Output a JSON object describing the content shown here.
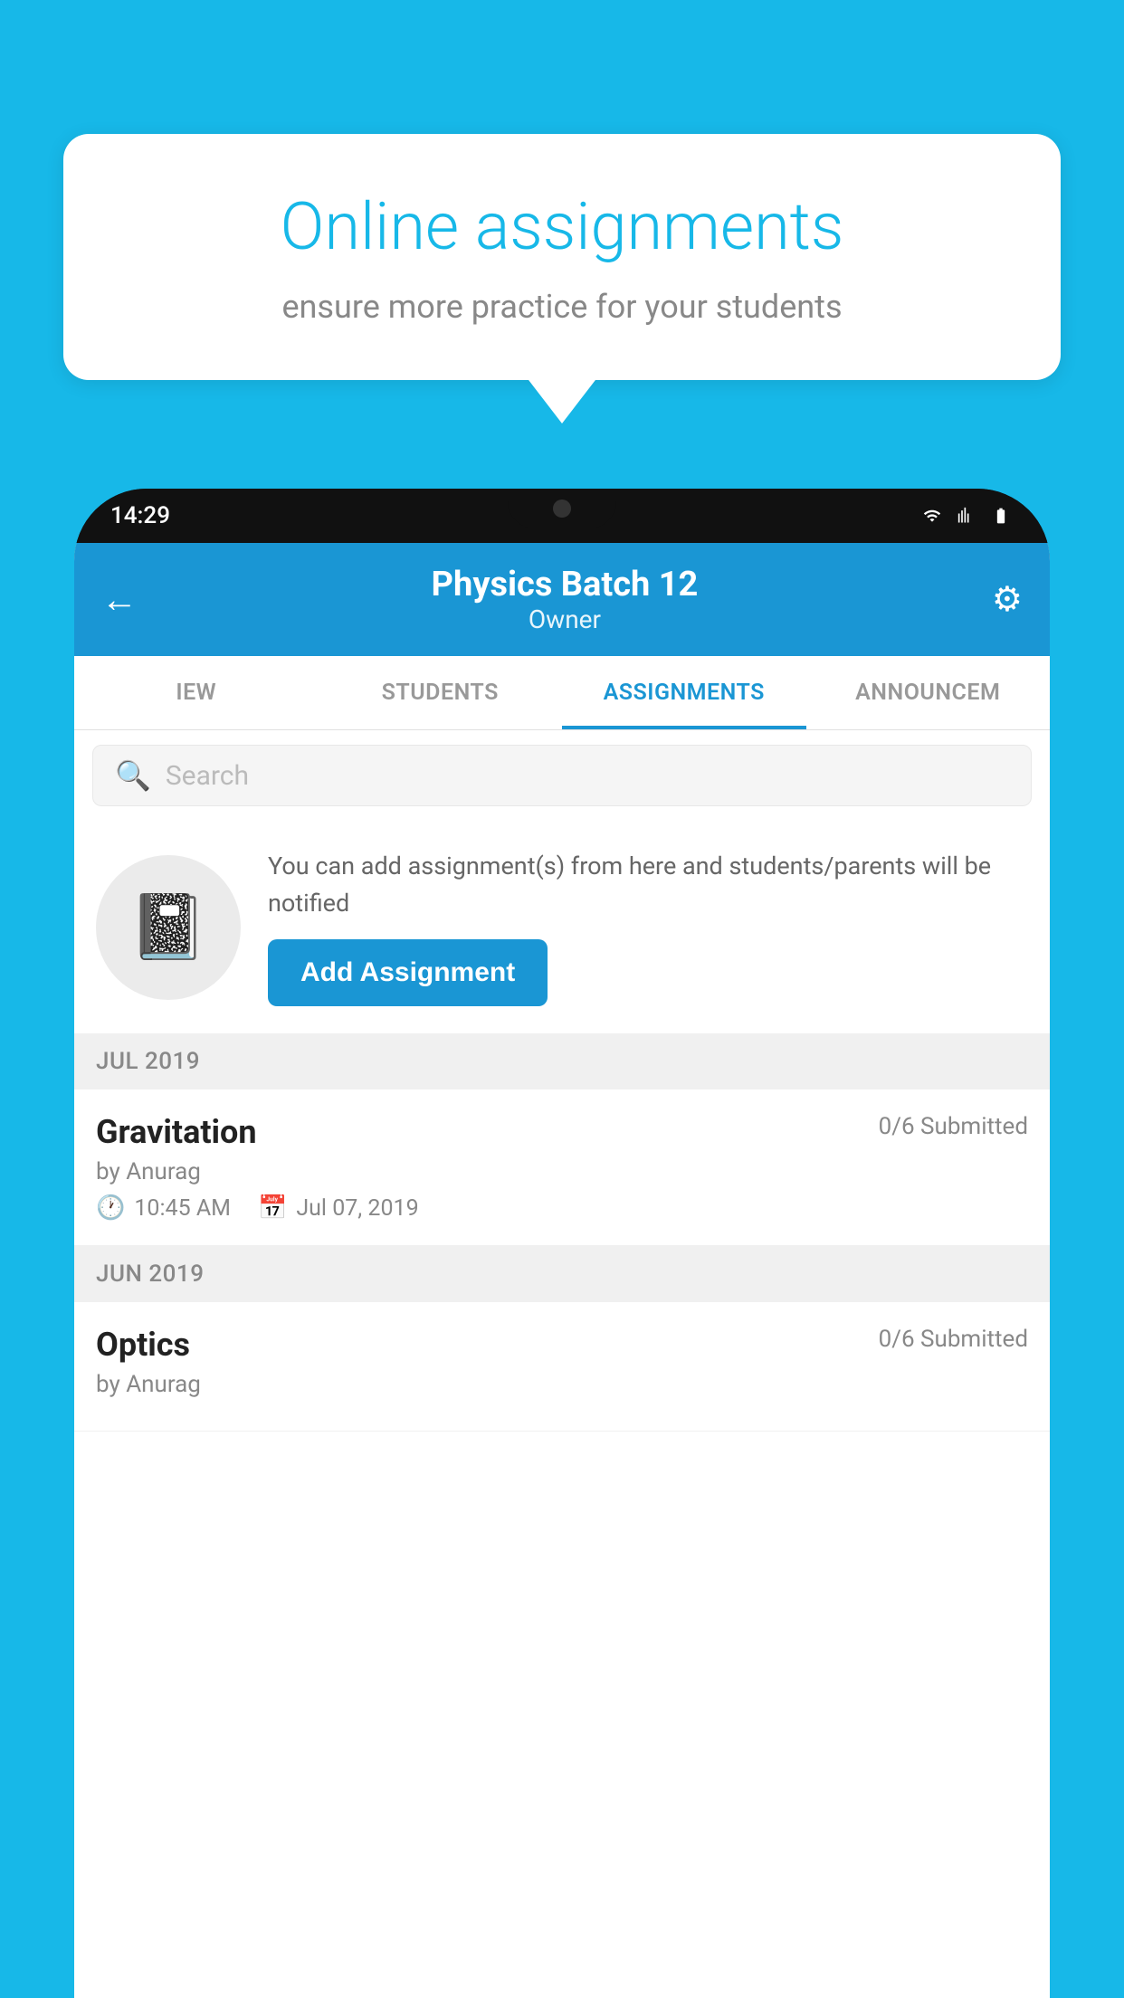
{
  "background_color": "#17b8e8",
  "speech_bubble": {
    "title": "Online assignments",
    "subtitle": "ensure more practice for your students"
  },
  "phone": {
    "status_bar": {
      "time": "14:29"
    },
    "header": {
      "title": "Physics Batch 12",
      "subtitle": "Owner",
      "back_label": "←",
      "gear_label": "⚙"
    },
    "tabs": [
      {
        "label": "IEW",
        "active": false
      },
      {
        "label": "STUDENTS",
        "active": false
      },
      {
        "label": "ASSIGNMENTS",
        "active": true
      },
      {
        "label": "ANNOUNCEM",
        "active": false
      }
    ],
    "search": {
      "placeholder": "Search"
    },
    "promo": {
      "text": "You can add assignment(s) from here and students/parents will be notified",
      "button_label": "Add Assignment"
    },
    "assignments": [
      {
        "section": "JUL 2019",
        "items": [
          {
            "name": "Gravitation",
            "submitted": "0/6 Submitted",
            "author": "by Anurag",
            "time": "10:45 AM",
            "date": "Jul 07, 2019"
          }
        ]
      },
      {
        "section": "JUN 2019",
        "items": [
          {
            "name": "Optics",
            "submitted": "0/6 Submitted",
            "author": "by Anurag",
            "time": "",
            "date": ""
          }
        ]
      }
    ]
  }
}
